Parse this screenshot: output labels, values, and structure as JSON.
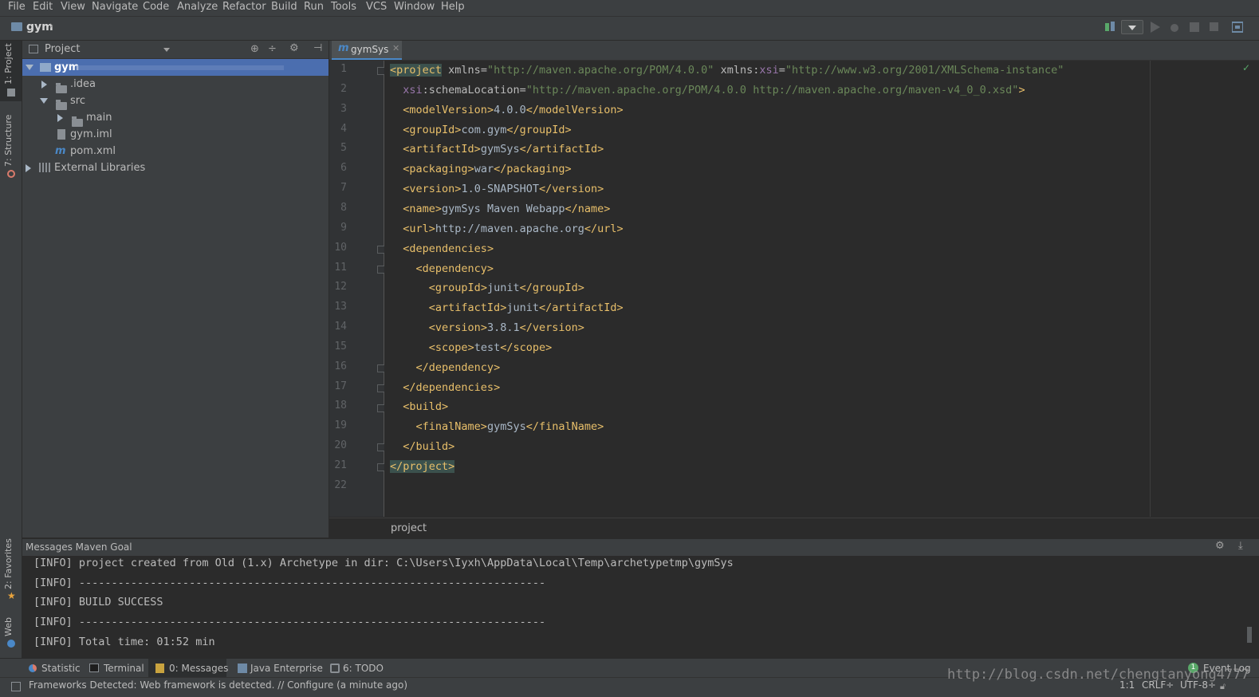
{
  "menu": [
    "File",
    "Edit",
    "View",
    "Navigate",
    "Code",
    "Analyze",
    "Refactor",
    "Build",
    "Run",
    "Tools",
    "VCS",
    "Window",
    "Help"
  ],
  "navbar": {
    "project": "gym"
  },
  "left_strip": {
    "project_tab": "1: Project",
    "structure_tab": "7: Structure",
    "favorites_tab": "2: Favorites",
    "web_tab": "Web"
  },
  "project_panel": {
    "title": "Project",
    "tree": [
      {
        "label": "gym",
        "level": 0,
        "expanded": true,
        "kind": "module"
      },
      {
        "label": ".idea",
        "level": 1,
        "expanded": false,
        "kind": "folder"
      },
      {
        "label": "src",
        "level": 1,
        "expanded": true,
        "kind": "folder"
      },
      {
        "label": "main",
        "level": 2,
        "expanded": false,
        "kind": "folder"
      },
      {
        "label": "gym.iml",
        "level": 1,
        "kind": "file"
      },
      {
        "label": "pom.xml",
        "level": 1,
        "kind": "maven"
      },
      {
        "label": "External Libraries",
        "level": 0,
        "expanded": false,
        "kind": "library"
      }
    ]
  },
  "editor": {
    "tab_label": "gymSys",
    "tab_icon": "m",
    "breadcrumb": "project",
    "line_numbers": [
      "1",
      "2",
      "3",
      "4",
      "5",
      "6",
      "7",
      "8",
      "9",
      "10",
      "11",
      "12",
      "13",
      "14",
      "15",
      "16",
      "17",
      "18",
      "19",
      "20",
      "21",
      "22"
    ],
    "code": [
      "<project xmlns=\"http://maven.apache.org/POM/4.0.0\" xmlns:xsi=\"http://www.w3.org/2001/XMLSchema-instance\"",
      "  xsi:schemaLocation=\"http://maven.apache.org/POM/4.0.0 http://maven.apache.org/maven-v4_0_0.xsd\">",
      "  <modelVersion>4.0.0</modelVersion>",
      "  <groupId>com.gym</groupId>",
      "  <artifactId>gymSys</artifactId>",
      "  <packaging>war</packaging>",
      "  <version>1.0-SNAPSHOT</version>",
      "  <name>gymSys Maven Webapp</name>",
      "  <url>http://maven.apache.org</url>",
      "  <dependencies>",
      "    <dependency>",
      "      <groupId>junit</groupId>",
      "      <artifactId>junit</artifactId>",
      "      <version>3.8.1</version>",
      "      <scope>test</scope>",
      "    </dependency>",
      "  </dependencies>",
      "  <build>",
      "    <finalName>gymSys</finalName>",
      "  </build>",
      "</project>",
      ""
    ]
  },
  "messages": {
    "title": "Messages Maven Goal",
    "lines": [
      "[INFO] project created from Old (1.x) Archetype in dir: C:\\Users\\Iyxh\\AppData\\Local\\Temp\\archetypetmp\\gymSys",
      "[INFO] ------------------------------------------------------------------------",
      "[INFO] BUILD SUCCESS",
      "[INFO] ------------------------------------------------------------------------",
      "[INFO] Total time: 01:52 min"
    ]
  },
  "bottom_tabs": [
    "Statistic",
    "Terminal",
    "0: Messages",
    "Java Enterprise",
    "6: TODO"
  ],
  "event_log": {
    "label": "Event Log",
    "count": "1"
  },
  "status": {
    "message": "Frameworks Detected: Web framework is detected. // Configure (a minute ago)",
    "position": "1:1",
    "line_sep": "CRLF÷",
    "encoding": "UTF-8÷"
  },
  "watermark": "http://blog.csdn.net/chengtanyong4777",
  "colors": {
    "accent": "#4a88c7",
    "tag": "#e8bf6a",
    "attr_value": "#6a8759",
    "namespace": "#9876aa",
    "background": "#2b2b2b",
    "panel": "#3c3f41"
  }
}
